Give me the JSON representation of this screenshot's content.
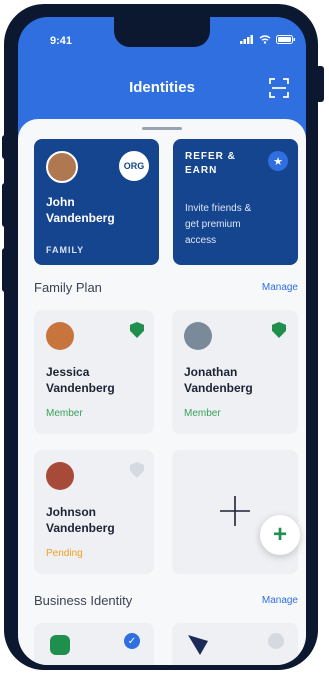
{
  "status": {
    "time": "9:41"
  },
  "header": {
    "title": "Identities"
  },
  "primary_card": {
    "name_line1": "John",
    "name_line2": "Vandenberg",
    "badge": "ORG",
    "label": "FAMILY"
  },
  "refer_card": {
    "title_line1": "REFER &",
    "title_line2": "EARN",
    "body_line1": "Invite friends &",
    "body_line2": "get premium",
    "body_line3": "access"
  },
  "family_section": {
    "title": "Family Plan",
    "manage": "Manage"
  },
  "members": [
    {
      "first": "Jessica",
      "last": "Vandenberg",
      "role": "Member",
      "role_color": "#3aa05c",
      "avatar": "#c8743d"
    },
    {
      "first": "Jonathan",
      "last": "Vandenberg",
      "role": "Member",
      "role_color": "#3aa05c",
      "avatar": "#7a8a99"
    },
    {
      "first": "Johnson",
      "last": "Vandenberg",
      "role": "Pending",
      "role_color": "#f0a020",
      "avatar": "#a84a3a"
    }
  ],
  "business_section": {
    "title": "Business Identity",
    "manage": "Manage"
  },
  "colors": {
    "primary": "#2f6fe0",
    "card": "#16458f",
    "success": "#1f8f4e"
  }
}
